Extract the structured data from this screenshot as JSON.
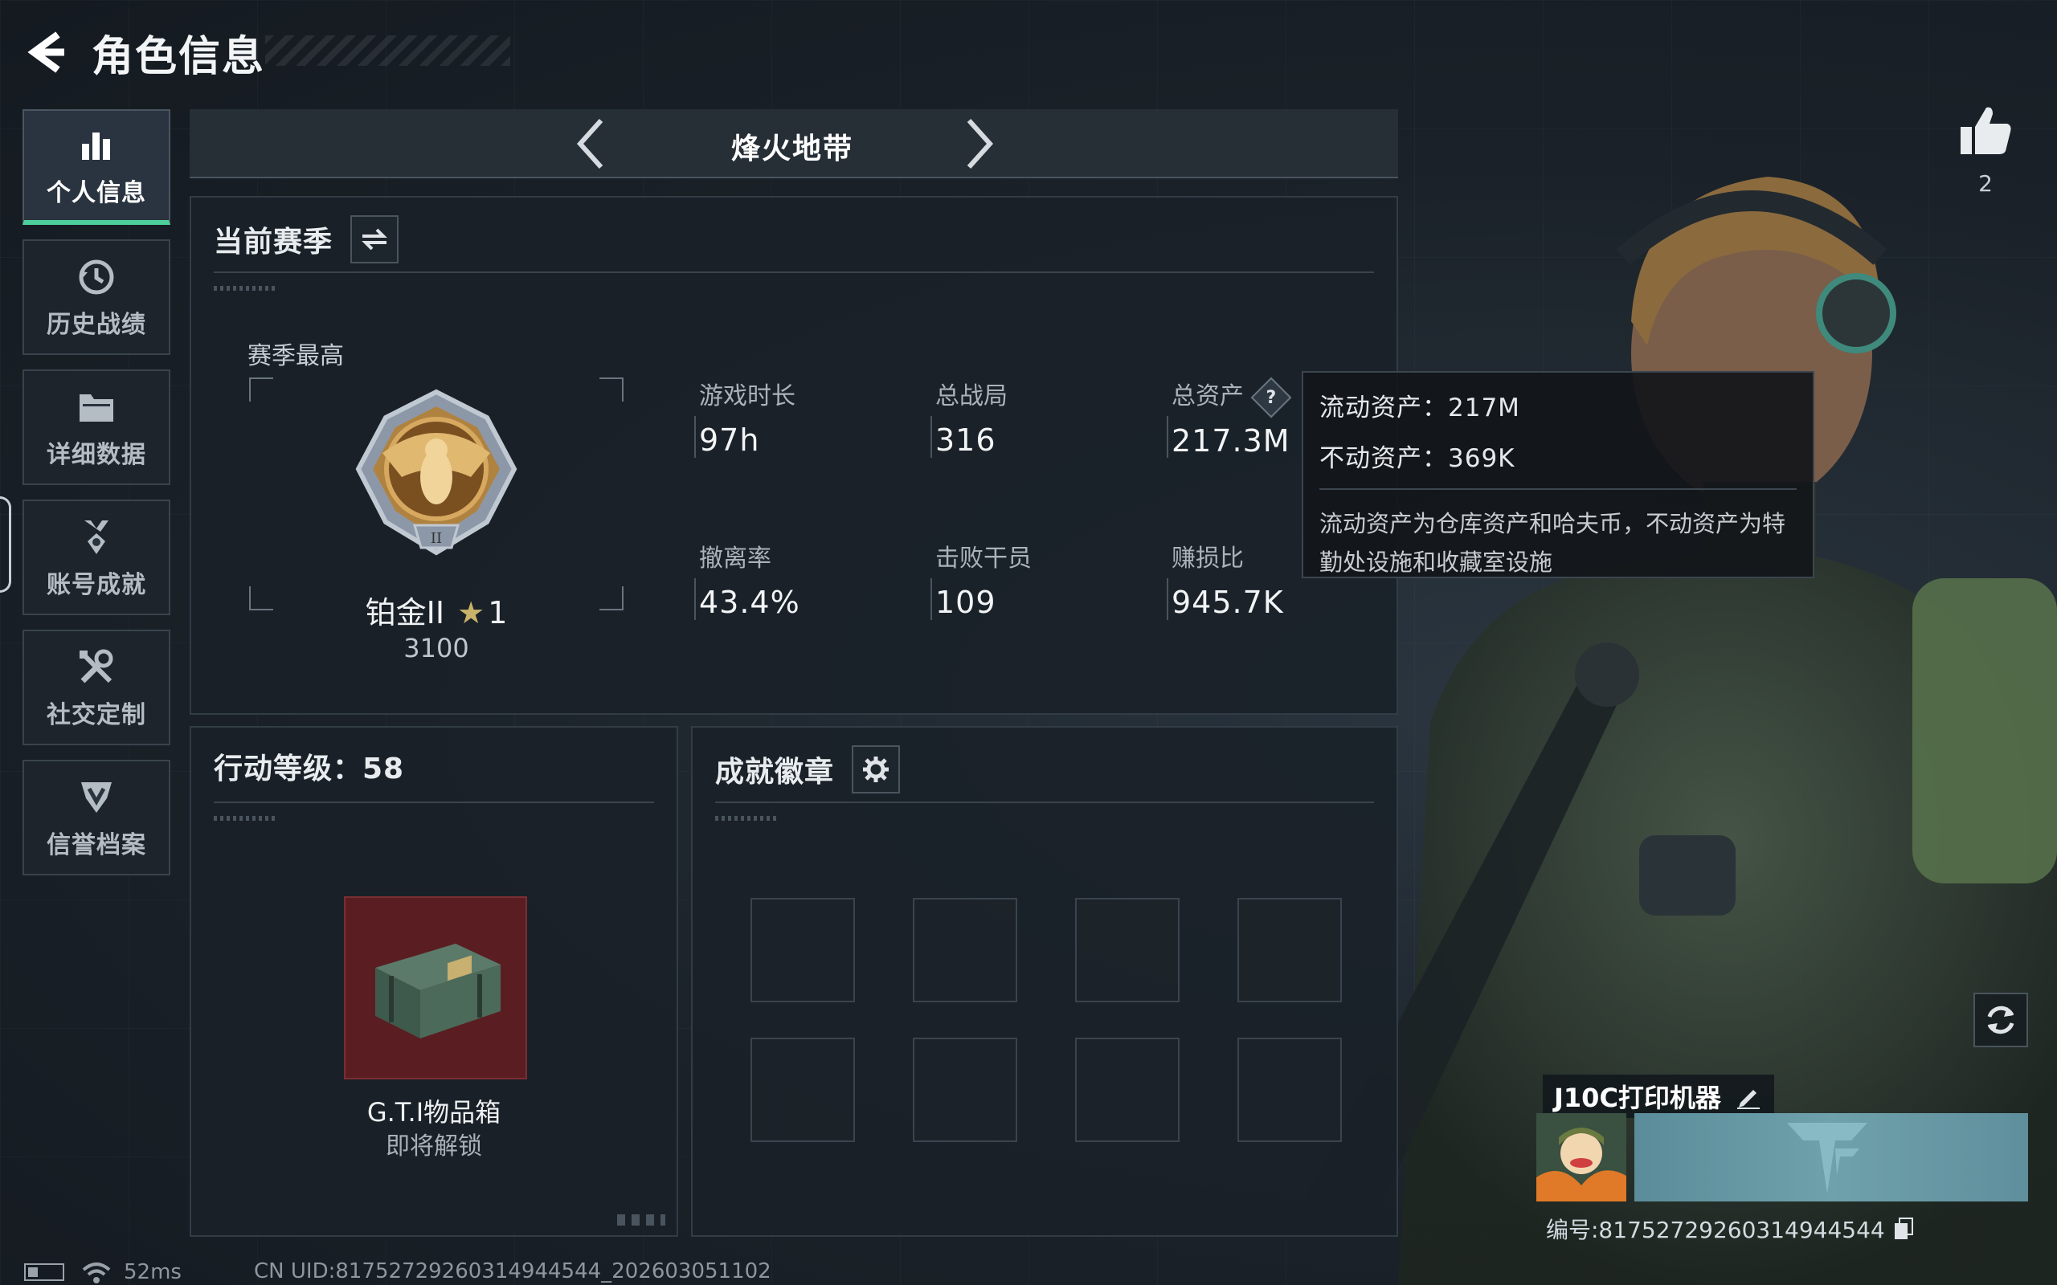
{
  "header": {
    "title": "角色信息"
  },
  "sidebar": {
    "items": [
      {
        "label": "个人信息",
        "icon": "bar-chart-icon",
        "active": true
      },
      {
        "label": "历史战绩",
        "icon": "history-clock-icon",
        "active": false
      },
      {
        "label": "详细数据",
        "icon": "folder-icon",
        "active": false
      },
      {
        "label": "账号成就",
        "icon": "achievement-medal-icon",
        "active": false
      },
      {
        "label": "社交定制",
        "icon": "tools-icon",
        "active": false
      },
      {
        "label": "信誉档案",
        "icon": "shield-rank-icon",
        "active": false
      }
    ]
  },
  "mode": {
    "title": "烽火地带"
  },
  "season": {
    "title": "当前赛季",
    "best_label": "赛季最高",
    "rank_name": "铂金II",
    "rank_stars": "1",
    "rank_points": "3100",
    "stats": [
      {
        "label": "游戏时长",
        "value": "97h"
      },
      {
        "label": "总战局",
        "value": "316"
      },
      {
        "label": "总资产",
        "value": "217.3M"
      },
      {
        "label": "撤离率",
        "value": "43.4%"
      },
      {
        "label": "击败干员",
        "value": "109"
      },
      {
        "label": "赚损比",
        "value": "945.7K"
      }
    ]
  },
  "tooltip": {
    "liquid": "流动资产：217M",
    "fixed": "不动资产：369K",
    "note": "流动资产为仓库资产和哈夫币，不动资产为特勤处设施和收藏室设施"
  },
  "level": {
    "title": "行动等级：58",
    "item_name": "G.T.I物品箱",
    "item_status": "即将解锁"
  },
  "achievements": {
    "title": "成就徽章"
  },
  "social": {
    "likes": "2"
  },
  "player": {
    "name": "J10C打印机器",
    "uid": "编号:81752729260314944544"
  },
  "status": {
    "ping": "52ms",
    "cn_uid": "CN UID:81752729260314944544_202603051102"
  },
  "colors": {
    "accent_green": "#4ccf9b",
    "background": "#1a2128",
    "chest_red": "#5a1e22"
  }
}
